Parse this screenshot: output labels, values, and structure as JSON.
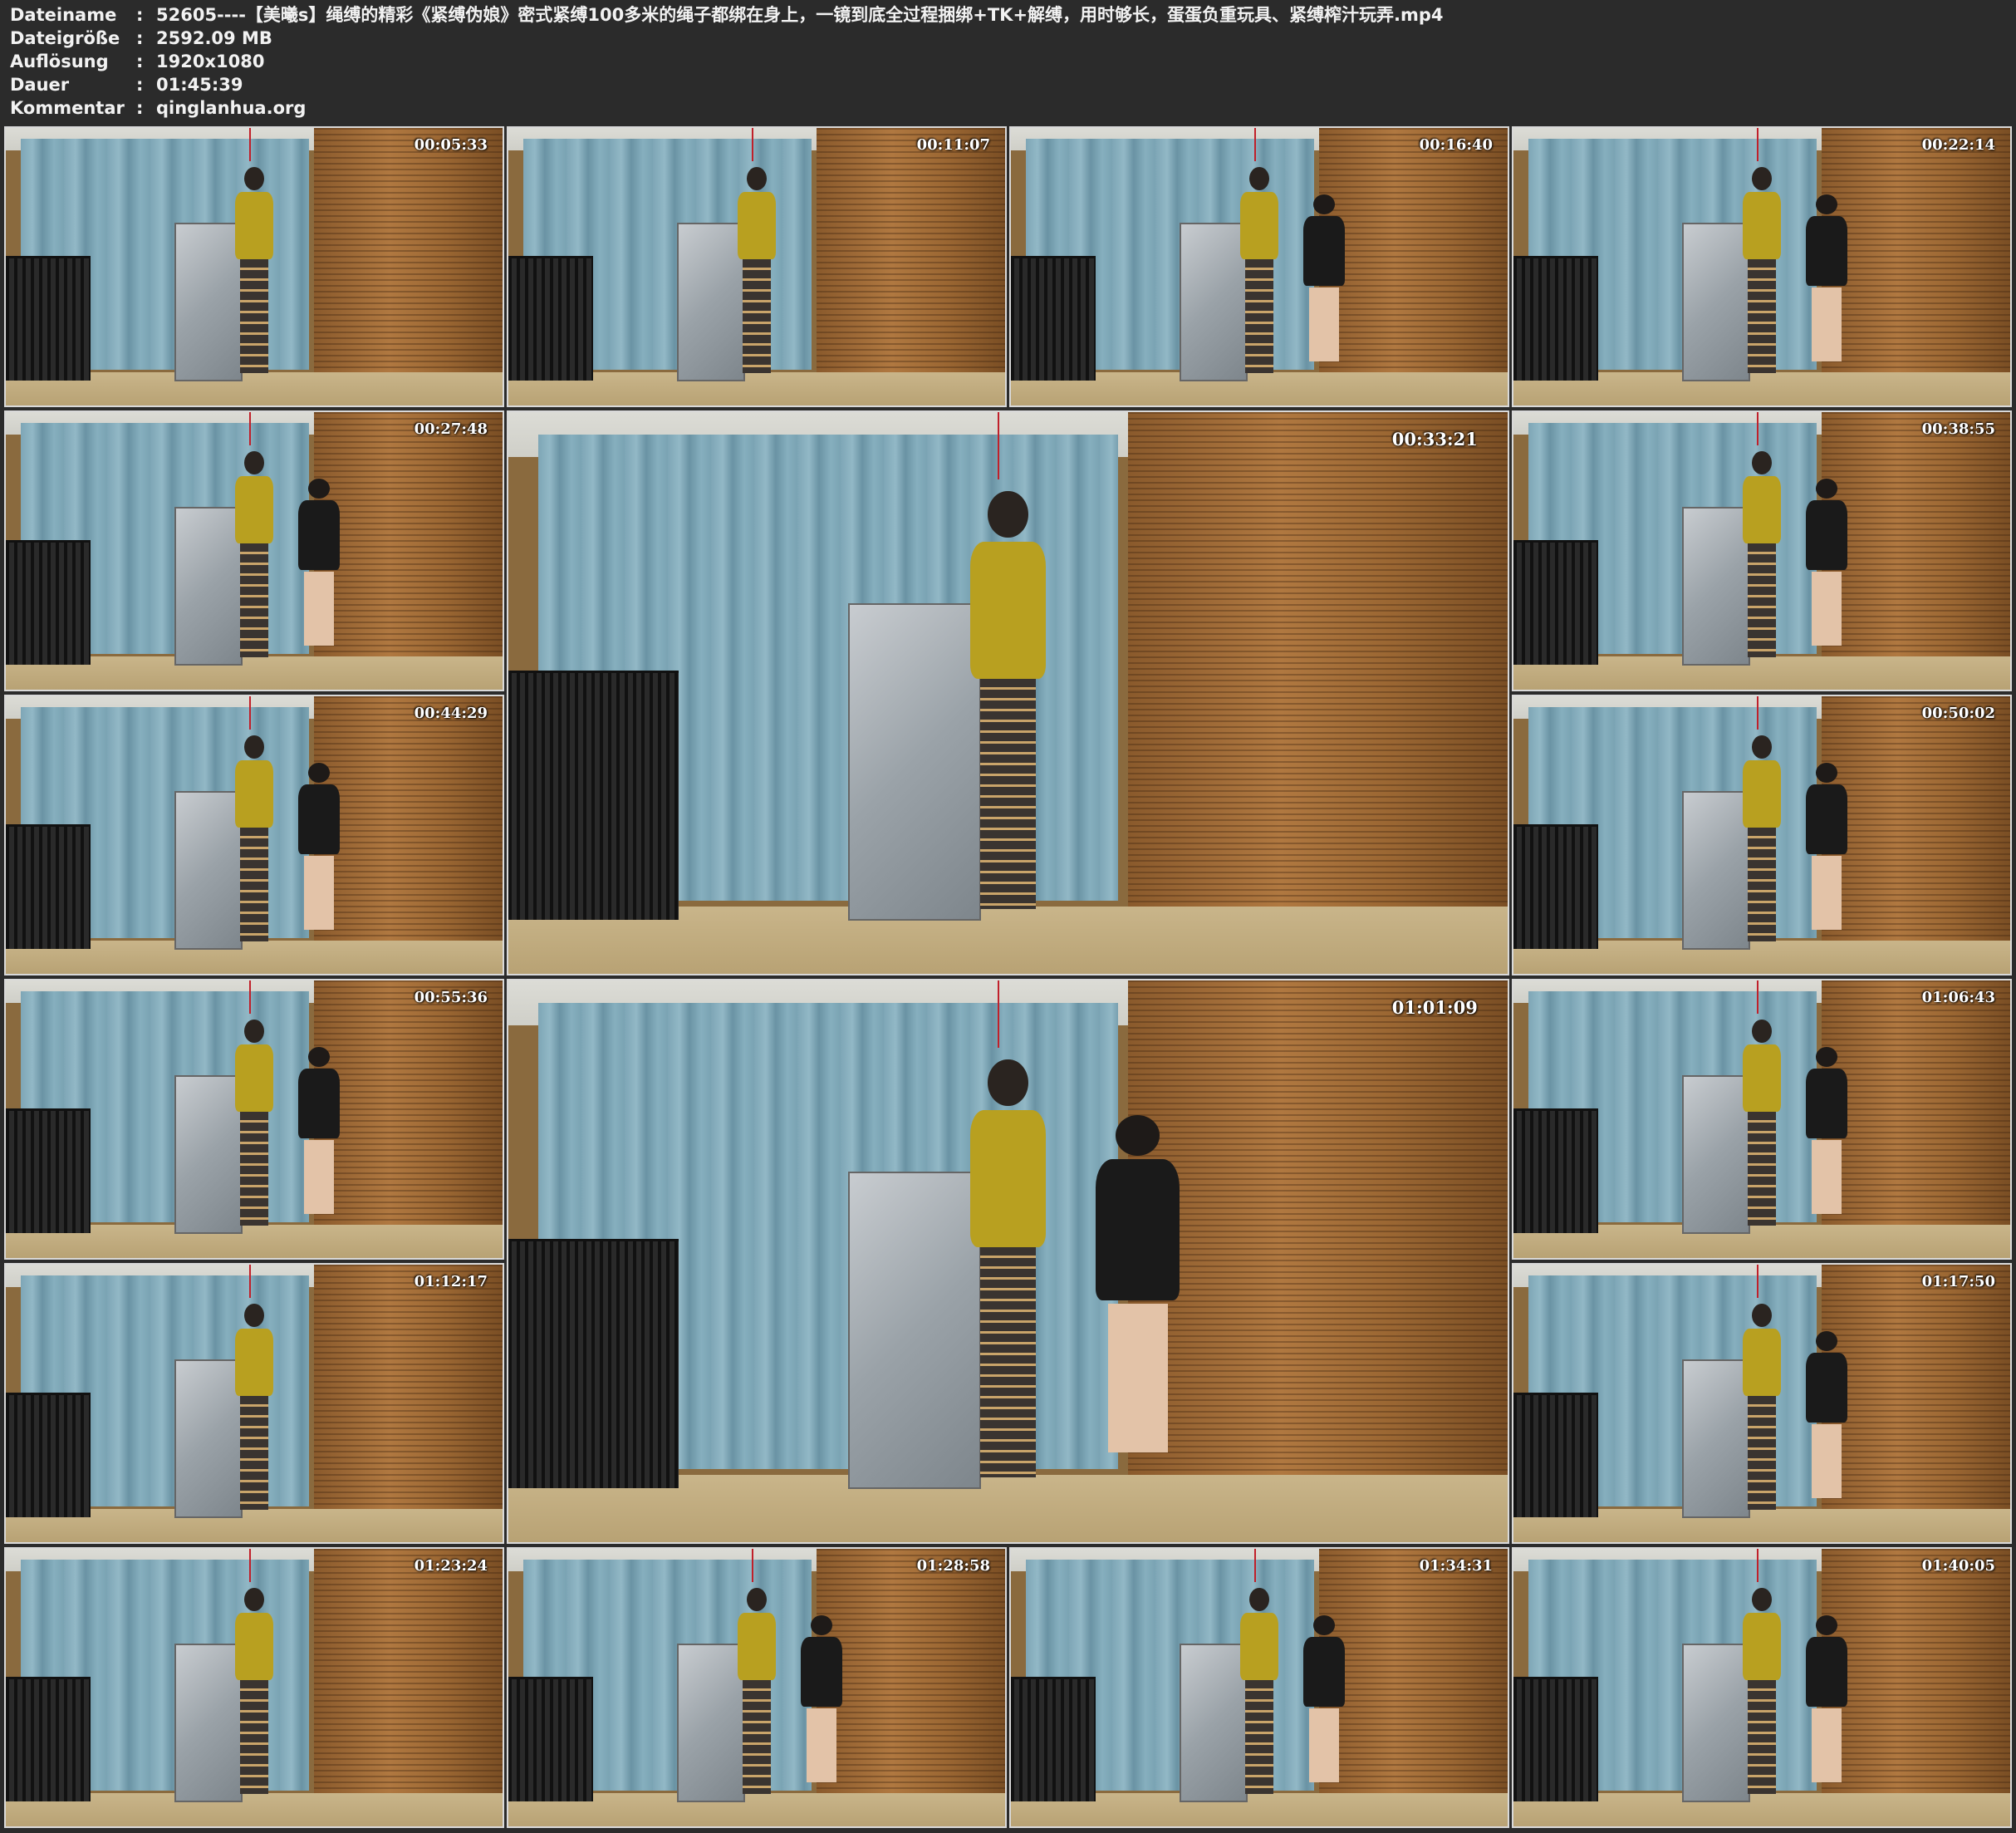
{
  "header": {
    "rows": [
      {
        "label": "Dateiname",
        "value": "52605----【美曦s】绳缚的精彩《紧缚伪娘》密式紧缚100多米的绳子都绑在身上，一镜到底全过程捆绑+TK+解缚，用时够长，蛋蛋负重玩具、紧缚榨汁玩弄.mp4"
      },
      {
        "label": "Dateigröße",
        "value": "2592.09 MB"
      },
      {
        "label": "Auflösung",
        "value": "1920x1080"
      },
      {
        "label": "Dauer",
        "value": "01:45:39"
      },
      {
        "label": "Kommentar",
        "value": "qinglanhua.org"
      }
    ],
    "separator": ":"
  },
  "thumbnails": [
    {
      "time": "00:05:33"
    },
    {
      "time": "00:11:07"
    },
    {
      "time": "00:16:40"
    },
    {
      "time": "00:22:14"
    },
    {
      "time": "00:27:48"
    },
    {
      "time": "00:33:21"
    },
    {
      "time": "00:38:55"
    },
    {
      "time": "00:44:29"
    },
    {
      "time": "00:50:02"
    },
    {
      "time": "00:55:36"
    },
    {
      "time": "01:01:09"
    },
    {
      "time": "01:06:43"
    },
    {
      "time": "01:12:17"
    },
    {
      "time": "01:17:50"
    },
    {
      "time": "01:23:24"
    },
    {
      "time": "01:28:58"
    },
    {
      "time": "01:34:31"
    },
    {
      "time": "01:40:05"
    }
  ],
  "colors": {
    "background": "#2b2b2b",
    "header_text": "#f2f2f2",
    "thumb_border": "#d9d9d9",
    "timestamp_text": "#ffffff"
  }
}
